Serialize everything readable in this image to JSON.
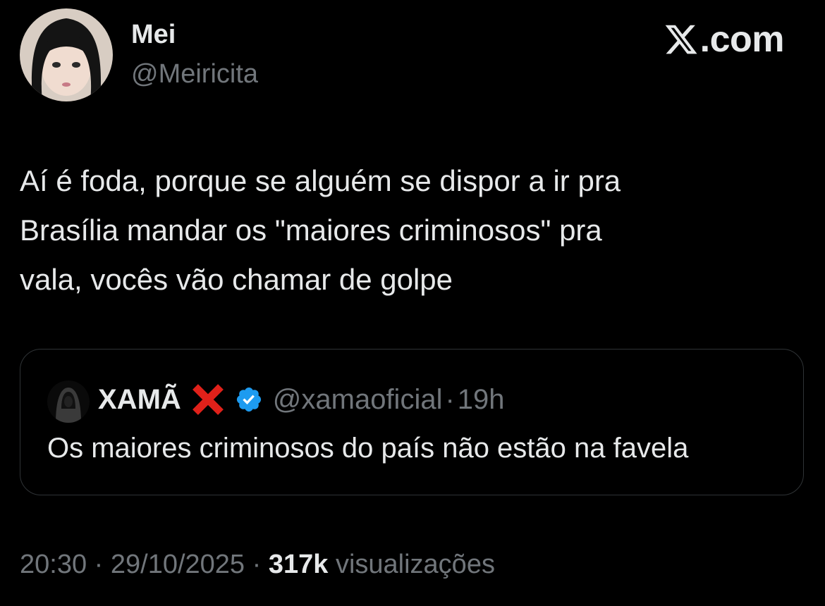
{
  "author": {
    "display_name": "Mei",
    "handle": "@Meiricita"
  },
  "brand": {
    "label": ".com",
    "icon": "x-logo-icon"
  },
  "tweet": {
    "text": "Aí é foda, porque se alguém se dispor a ir pra\nBrasília mandar os \"maiores criminosos\" pra\nvala, vocês vão chamar de golpe"
  },
  "quoted": {
    "display_name": "XAMÃ",
    "name_emoji": "cross-mark-icon",
    "verified_icon": "verified-badge-icon",
    "handle": "@xamaoficial",
    "separator": "·",
    "time": "19h",
    "text": "Os maiores criminosos do país não estão na favela"
  },
  "meta": {
    "time": "20:30",
    "date": "29/10/2025",
    "separator": "·",
    "views_count": "317k",
    "views_label": "visualizações"
  },
  "colors": {
    "background": "#000000",
    "primary_text": "#e7e9ea",
    "secondary_text": "#71767b",
    "border": "#2f3336",
    "verified_blue": "#1d9bf0",
    "cross_red": "#e0211a"
  }
}
